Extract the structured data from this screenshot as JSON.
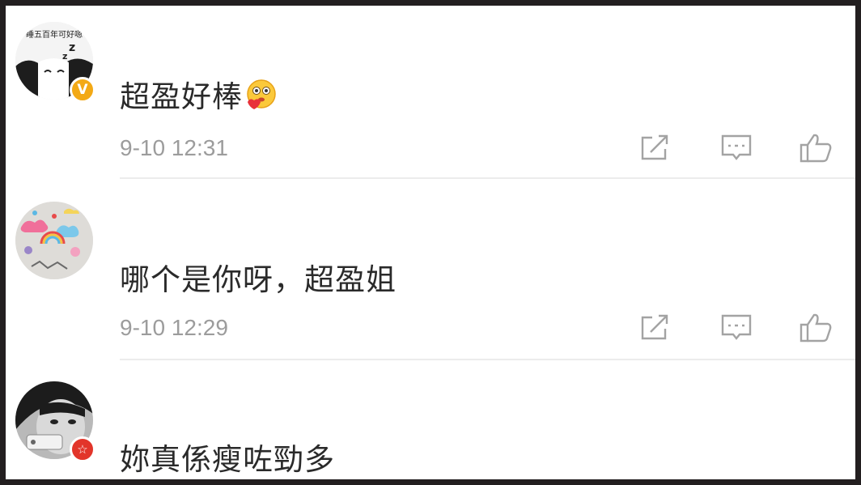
{
  "comments": [
    {
      "text": "超盈好棒",
      "time": "9-10 12:31",
      "avatar_text": "睡五百年可好嗯",
      "badge": "V",
      "emoji": "hug-emoji"
    },
    {
      "text": "哪个是你呀，超盈姐",
      "time": "9-10 12:29"
    },
    {
      "text": "妳真係瘦咗勁多",
      "badge": "☆"
    }
  ],
  "icons": {
    "share": "share-icon",
    "comment": "comment-icon",
    "like": "like-icon"
  },
  "colors": {
    "text": "#2a2a2a",
    "time": "#9c9c9c",
    "icon": "#a3a3a3",
    "verified_badge": "#f3a915",
    "star_badge": "#e2352a",
    "frame": "#231f20",
    "divider": "#ececec"
  }
}
